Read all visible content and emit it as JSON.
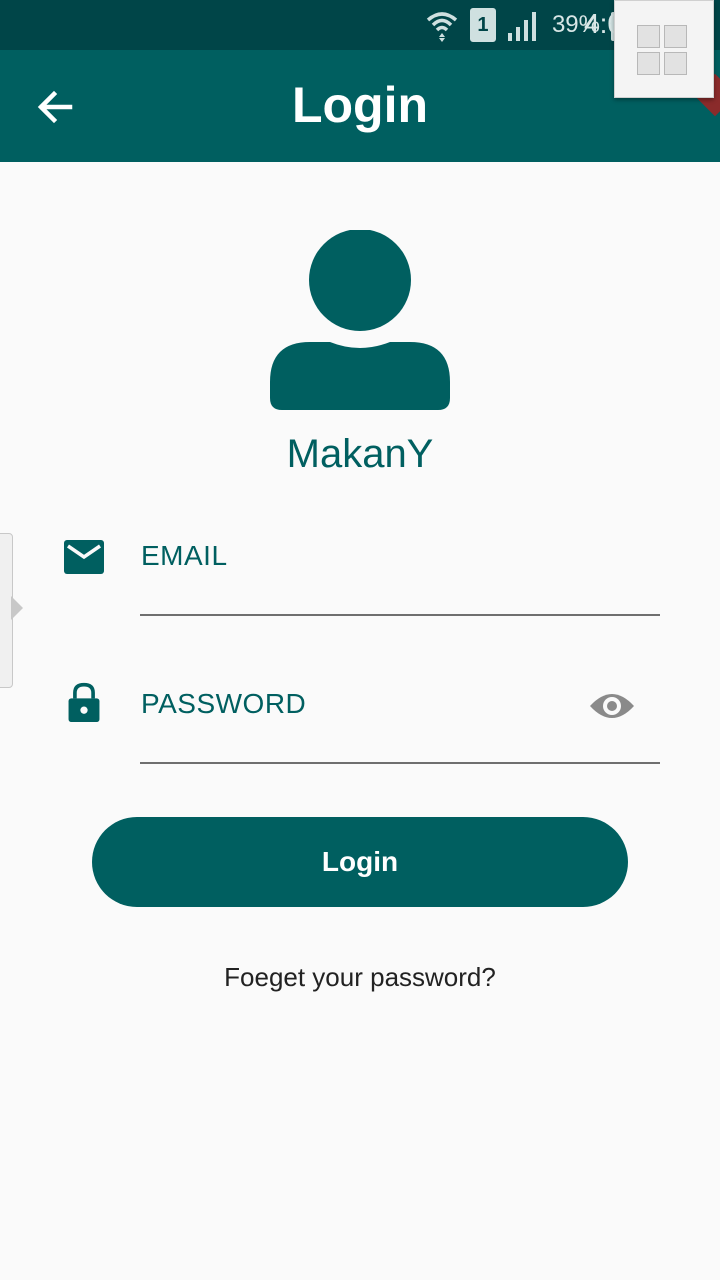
{
  "status_bar": {
    "sim_slot": "1",
    "battery_percent": "39%",
    "time": "4:0",
    "icons": [
      "wifi-icon",
      "sim-icon",
      "signal-icon",
      "battery-charging-icon"
    ]
  },
  "app_bar": {
    "title": "Login",
    "back_icon": "arrow-left-icon"
  },
  "profile": {
    "avatar_icon": "person-icon",
    "brand_name": "MakanY"
  },
  "form": {
    "email": {
      "label": "EMAIL",
      "icon": "mail-icon"
    },
    "password": {
      "label": "PASSWORD",
      "icon": "lock-icon",
      "toggle_icon": "eye-icon"
    }
  },
  "actions": {
    "login_label": "Login",
    "forgot_label": "Foeget your password?"
  },
  "colors": {
    "primary": "#005f60",
    "status_bar": "#004548",
    "background": "#fafafa"
  }
}
